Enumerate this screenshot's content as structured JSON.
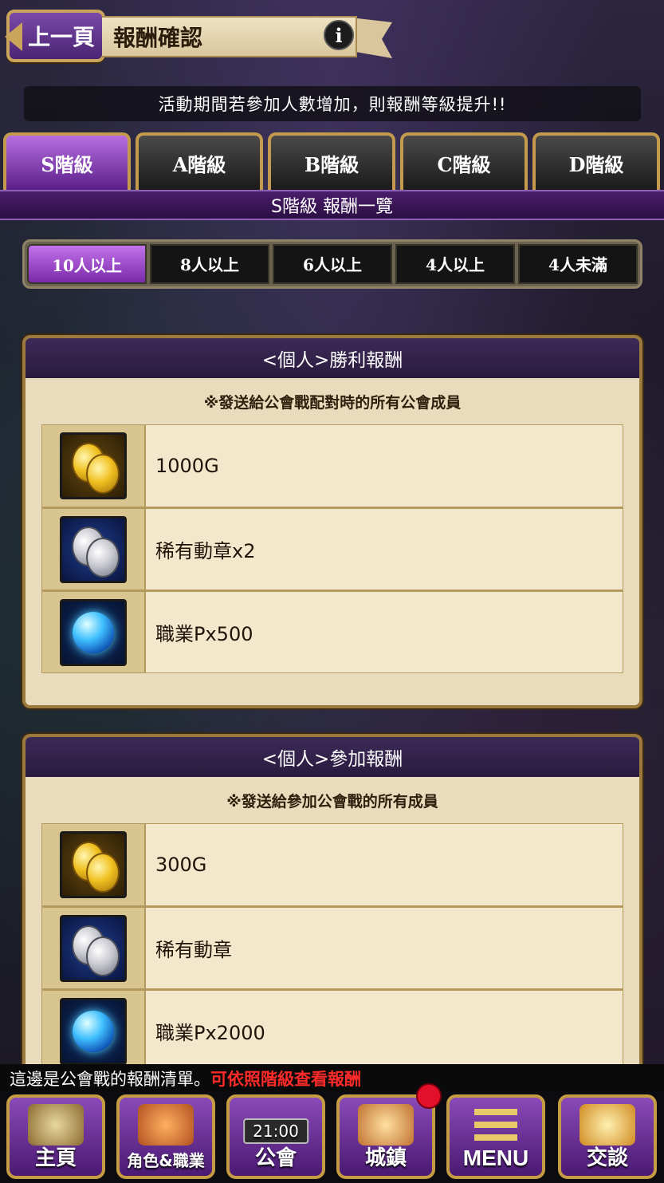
{
  "header": {
    "back_label": "上一頁",
    "title": "報酬確認",
    "info_icon": "i"
  },
  "notice": "活動期間若參加人數增加，則報酬等級提升!!",
  "rank_tabs": [
    {
      "label": "S階級",
      "active": true
    },
    {
      "label": "A階級",
      "active": false
    },
    {
      "label": "B階級",
      "active": false
    },
    {
      "label": "C階級",
      "active": false
    },
    {
      "label": "D階級",
      "active": false
    }
  ],
  "rank_strip": "S階級 報酬一覽",
  "count_tabs": [
    {
      "label": "10人以上",
      "active": true
    },
    {
      "label": "8人以上",
      "active": false
    },
    {
      "label": "6人以上",
      "active": false
    },
    {
      "label": "4人以上",
      "active": false
    },
    {
      "label": "4人未滿",
      "active": false
    }
  ],
  "panels": [
    {
      "title": "<個人>勝利報酬",
      "note": "※發送給公會戰配對時的所有公會成員",
      "rewards": [
        {
          "icon": "gold-coin-icon",
          "text": "1000G"
        },
        {
          "icon": "medal-icon",
          "text": "稀有動章x2"
        },
        {
          "icon": "job-orb-icon",
          "text": "職業Px500"
        }
      ]
    },
    {
      "title": "<個人>參加報酬",
      "note": "※發送給參加公會戰的所有成員",
      "rewards": [
        {
          "icon": "gold-coin-icon",
          "text": "300G"
        },
        {
          "icon": "medal-icon",
          "text": "稀有動章"
        },
        {
          "icon": "job-orb-icon",
          "text": "職業Px2000"
        }
      ]
    }
  ],
  "footer": {
    "message": "這邊是公會戰的報酬清單。",
    "message_highlight": "可依照階級查看報酬"
  },
  "nav": {
    "home": "主頁",
    "chara": "角色&職業",
    "guild": "公會",
    "guild_time": "21:00",
    "town": "城鎮",
    "menu": "MENU",
    "chat": "交談"
  },
  "colors": {
    "accent_purple": "#7a2aa8",
    "gold_border": "#c49a4c",
    "highlight_red": "#ff2a2a"
  }
}
